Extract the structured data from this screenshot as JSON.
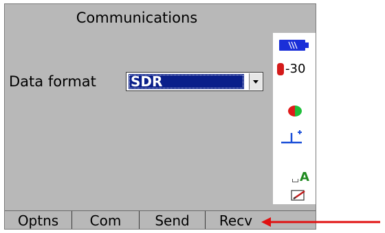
{
  "window": {
    "title": "Communications"
  },
  "form": {
    "data_format_label": "Data format",
    "data_format_value": "SDR"
  },
  "status": {
    "battery_icon": "battery-icon",
    "prism_constant": "-30",
    "input_mode": "A"
  },
  "softkeys": [
    {
      "label": "Optns"
    },
    {
      "label": "Com"
    },
    {
      "label": "Send"
    },
    {
      "label": "Recv"
    }
  ],
  "colors": {
    "screen_background": "#b8b8b8",
    "selection_highlight": "#0a1f8a",
    "battery": "#1a2fd8",
    "annotation_arrow": "#e01010"
  }
}
